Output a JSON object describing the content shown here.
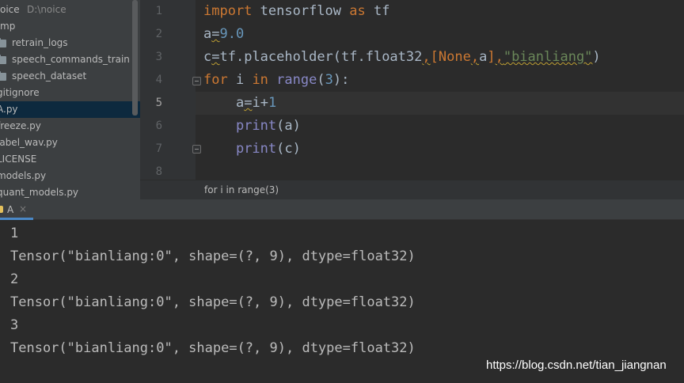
{
  "project_tree": {
    "root_name": "oice",
    "root_path": "D:\\noice",
    "items": [
      {
        "label": "mp"
      },
      {
        "label": "retrain_logs"
      },
      {
        "label": "speech_commands_train"
      },
      {
        "label": "speech_dataset"
      },
      {
        "label": "gitignore"
      },
      {
        "label": "A.py"
      },
      {
        "label": "freeze.py"
      },
      {
        "label": "label_wav.py"
      },
      {
        "label": "LICENSE"
      },
      {
        "label": "models.py"
      },
      {
        "label": "quant_models.py"
      }
    ]
  },
  "editor": {
    "line_numbers": [
      "1",
      "2",
      "3",
      "4",
      "5",
      "6",
      "7",
      "8"
    ],
    "current_line": 5,
    "code": {
      "l1": {
        "import": "import",
        "module": " tensorflow ",
        "as": "as",
        "alias": " tf"
      },
      "l2": {
        "a": "a",
        "eq": "=",
        "val": "9.0"
      },
      "l3": {
        "c": "c",
        "eq": "=",
        "call": "tf.placeholder(tf.float32",
        "c1": ",",
        "lb": "[",
        "none": "None",
        "c2": ",",
        "a": "a",
        "rb": "]",
        "c3": ",",
        "str": "\"bianliang\"",
        "rp": ")"
      },
      "l4": {
        "for": "for",
        "var": " i ",
        "in": "in",
        "sp": " ",
        "range": "range",
        "lp": "(",
        "num": "3",
        "rp": "):"
      },
      "l5": {
        "indent": "    ",
        "a": "a",
        "eq": "=",
        "rest": "i+",
        "num": "1"
      },
      "l6": {
        "indent": "    ",
        "print": "print",
        "args": "(a)"
      },
      "l7": {
        "indent": "    ",
        "print": "print",
        "args": "(c)"
      }
    }
  },
  "breadcrumb": "for i in range(3)",
  "run_tab": {
    "label": "A",
    "close": "×"
  },
  "console_output": [
    "1",
    "Tensor(\"bianliang:0\", shape=(?, 9), dtype=float32)",
    "2",
    "Tensor(\"bianliang:0\", shape=(?, 9), dtype=float32)",
    "3",
    "Tensor(\"bianliang:0\", shape=(?, 9), dtype=float32)"
  ],
  "watermark": "https://blog.csdn.net/tian_jiangnan",
  "colors": {
    "keyword": "#cc7832",
    "number": "#6897bb",
    "string": "#6a8759",
    "builtin": "#8888c6",
    "selection": "#0d293e",
    "tab_accent": "#4a88c7"
  }
}
